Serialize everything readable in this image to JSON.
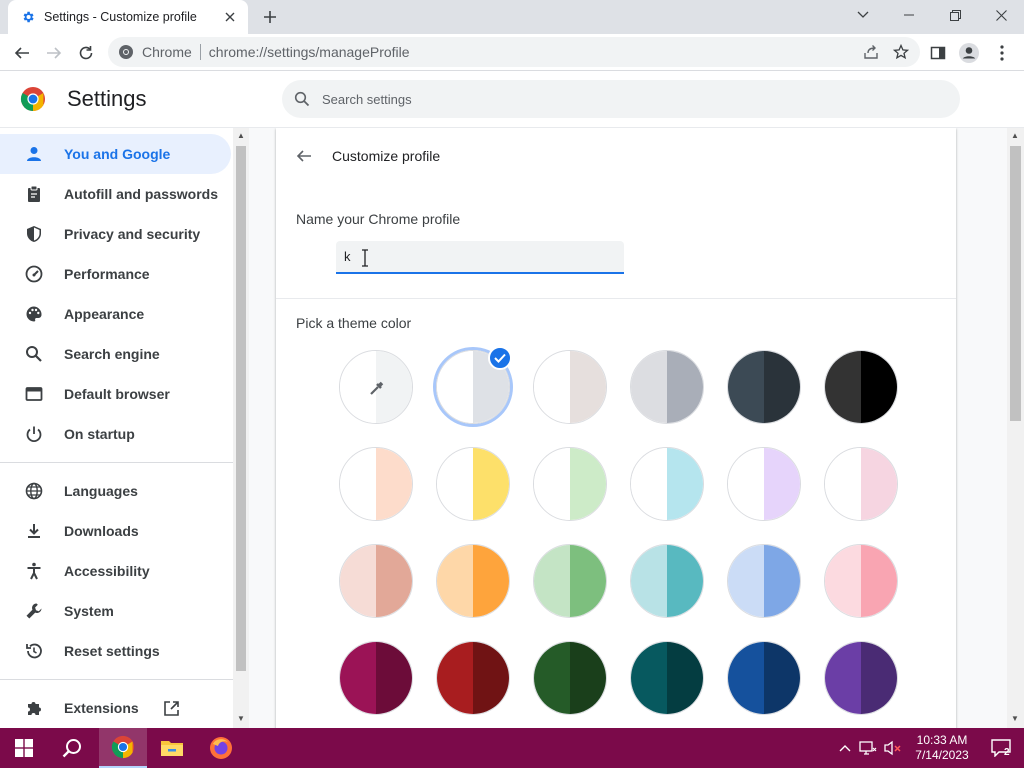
{
  "window": {
    "tab_title": "Settings - Customize profile",
    "tab_icon": "gear-icon",
    "new_tab_icon": "plus-icon",
    "controls": [
      "chevron-down-icon",
      "minimize-icon",
      "restore-icon",
      "close-icon"
    ]
  },
  "toolbar": {
    "site_chip": "Chrome",
    "url": "chrome://settings/manageProfile",
    "right_icons": [
      "share-icon",
      "star-icon",
      "side-panel-icon",
      "profile-icon",
      "more-icon"
    ]
  },
  "header": {
    "title": "Settings",
    "search_placeholder": "Search settings"
  },
  "sidebar": {
    "items": [
      {
        "label": "You and Google",
        "icon": "person-icon",
        "active": true
      },
      {
        "label": "Autofill and passwords",
        "icon": "clipboard-icon"
      },
      {
        "label": "Privacy and security",
        "icon": "shield-icon"
      },
      {
        "label": "Performance",
        "icon": "speedometer-icon"
      },
      {
        "label": "Appearance",
        "icon": "palette-icon"
      },
      {
        "label": "Search engine",
        "icon": "search-icon"
      },
      {
        "label": "Default browser",
        "icon": "browser-icon"
      },
      {
        "label": "On startup",
        "icon": "power-icon"
      }
    ],
    "items2": [
      {
        "label": "Languages",
        "icon": "globe-icon"
      },
      {
        "label": "Downloads",
        "icon": "download-icon"
      },
      {
        "label": "Accessibility",
        "icon": "accessibility-icon"
      },
      {
        "label": "System",
        "icon": "wrench-icon"
      },
      {
        "label": "Reset settings",
        "icon": "history-icon"
      }
    ],
    "extensions": {
      "label": "Extensions",
      "icon": "puzzle-icon",
      "link_icon": "open-external-icon"
    }
  },
  "main": {
    "card_title": "Customize profile",
    "name_label": "Name your Chrome profile",
    "name_value": "k",
    "theme_label": "Pick a theme color",
    "selected_theme_index": 1,
    "themes": [
      [
        "#ffffff",
        "#f1f3f4"
      ],
      [
        "#ffffff",
        "#dee1e6"
      ],
      [
        "#ffffff",
        "#e6dfdd"
      ],
      [
        "#dcdde1",
        "#a9aeb8"
      ],
      [
        "#3c4a55",
        "#2a333a"
      ],
      [
        "#333333",
        "#000000"
      ],
      [
        "#ffffff",
        "#fddccb"
      ],
      [
        "#ffffff",
        "#fde06a"
      ],
      [
        "#ffffff",
        "#cdebc8"
      ],
      [
        "#ffffff",
        "#b5e5ee"
      ],
      [
        "#ffffff",
        "#e6d4fb"
      ],
      [
        "#ffffff",
        "#f6d5e1"
      ],
      [
        "#f6dcd6",
        "#e2a898"
      ],
      [
        "#fed7a8",
        "#fea43c"
      ],
      [
        "#c4e4c5",
        "#7dbf7e"
      ],
      [
        "#b8e2e6",
        "#58b9c0"
      ],
      [
        "#cbdcf6",
        "#7ea7e6"
      ],
      [
        "#fcdae0",
        "#f9a5b2"
      ],
      [
        "#9b1356",
        "#6c0c39"
      ],
      [
        "#a81d1f",
        "#701314"
      ],
      [
        "#255b28",
        "#1a3f1b"
      ],
      [
        "#07595f",
        "#043d41"
      ],
      [
        "#15519d",
        "#0d3668"
      ],
      [
        "#6b3ea6",
        "#4a2b74"
      ]
    ]
  },
  "taskbar": {
    "apps": [
      "windows-start-icon",
      "search-icon",
      "chrome-icon",
      "file-explorer-icon",
      "firefox-icon"
    ],
    "time": "10:33 AM",
    "date": "7/14/2023"
  },
  "colors": {
    "accent": "#1a73e8",
    "taskbar": "#7b0a4a"
  }
}
